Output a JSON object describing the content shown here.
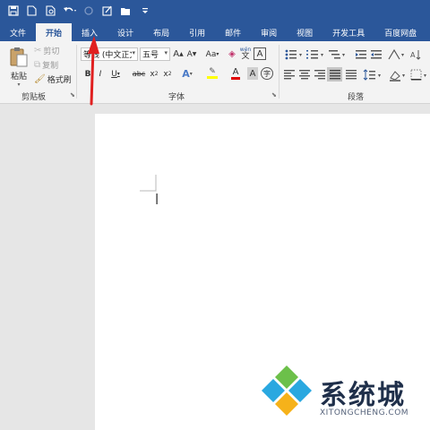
{
  "quick_access": {
    "icons": [
      "save-icon",
      "new-doc-icon",
      "print-preview-icon",
      "undo-icon",
      "redo-icon",
      "format-painter-icon",
      "open-icon",
      "customize-icon"
    ]
  },
  "tabs": [
    "文件",
    "开始",
    "插入",
    "设计",
    "布局",
    "引用",
    "邮件",
    "审阅",
    "视图",
    "开发工具",
    "百度网盘"
  ],
  "active_tab": "开始",
  "clipboard": {
    "paste": "粘贴",
    "cut": "剪切",
    "copy": "复制",
    "format_painter": "格式刷",
    "group_label": "剪贴板"
  },
  "font": {
    "font_name": "等线 (中文正文)",
    "font_size": "五号",
    "grow": "A",
    "shrink": "A",
    "change_case": "Aa",
    "pinyin": "wén",
    "pinyin_char": "文",
    "border_char": "A",
    "bold": "B",
    "italic": "I",
    "underline": "U",
    "strike": "abc",
    "subscript": "x",
    "superscript": "x",
    "text_effect": "A",
    "font_color": "A",
    "char_shade": "A",
    "enclose_char": "字",
    "group_label": "字体"
  },
  "paragraph": {
    "group_label": "段落"
  },
  "colors": {
    "accent": "#2b579a",
    "highlight": "#ffff00",
    "font_color": "#e00000",
    "annotation": "#e02020"
  },
  "watermark": {
    "brand": "系统城",
    "domain": "XITONGCHENG.COM"
  }
}
